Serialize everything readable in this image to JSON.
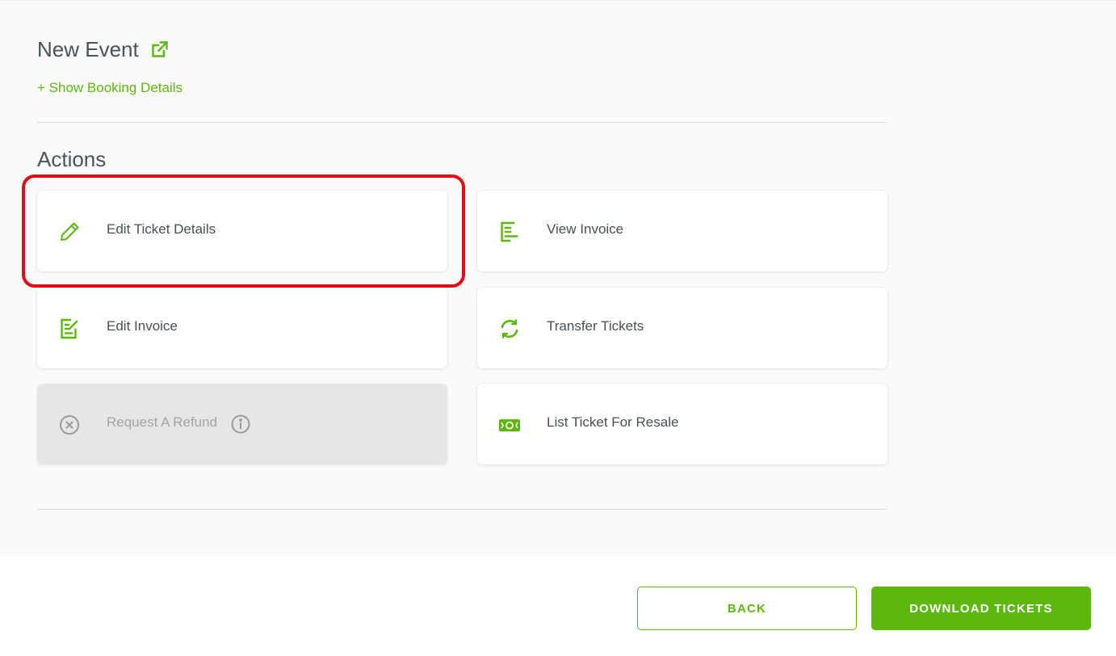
{
  "event": {
    "title": "New Event",
    "booking_link": "+ Show Booking Details"
  },
  "actions": {
    "heading": "Actions",
    "items": [
      {
        "label": "Edit Ticket Details",
        "icon": "pencil-icon",
        "enabled": true,
        "highlighted": true
      },
      {
        "label": "View Invoice",
        "icon": "document-icon",
        "enabled": true
      },
      {
        "label": "Edit Invoice",
        "icon": "edit-document-icon",
        "enabled": true
      },
      {
        "label": "Transfer Tickets",
        "icon": "refresh-icon",
        "enabled": true
      },
      {
        "label": "Request A Refund",
        "icon": "circle-x-icon",
        "enabled": false
      },
      {
        "label": "List Ticket For Resale",
        "icon": "banknote-icon",
        "enabled": true
      }
    ]
  },
  "footer": {
    "back_label": "BACK",
    "download_label": "DOWNLOAD TICKETS"
  },
  "colors": {
    "accent": "#5cb80c",
    "highlight": "#e00d12",
    "disabled_text": "#a3a3a3"
  }
}
